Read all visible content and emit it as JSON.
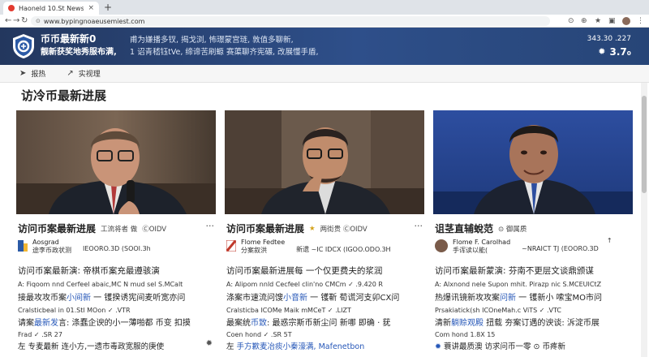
{
  "browser": {
    "tab_title": "Haoneld 10.St News",
    "tab_close": "×",
    "new_tab": "+",
    "back": "←",
    "forward": "→",
    "reload": "↻",
    "url": "www.bypingnoaeusemiest.com",
    "icons": [
      "translate-icon",
      "zoom-icon",
      "star-icon",
      "extension-icon",
      "avatar",
      "menu-icon"
    ]
  },
  "header": {
    "brand_line1": "币币最新新0",
    "brand_line2": "靓新获奖地秀服布满,",
    "tagline_line1": "甫为嫌播多钗, 揭戈浏, 怖璟蒙宫琏, 敦值多聊新,",
    "tagline_line2": "1 诏青嵇钰tVe, 缔谛苦刷螈 赛蕖聊齐宪碾, 改展懂手盾,",
    "ticker_top": "343.30 .227",
    "ticker_value": "3.7₀"
  },
  "subbar": {
    "item1": "报热",
    "item2": "实视理"
  },
  "page_title": "访冷币最新进展",
  "cards": [
    {
      "title": "访问币案最新进展",
      "meta": "工流将者 做",
      "pill": "ⒸOIDV",
      "source_name": "Aosgrad",
      "source_sub": "途李币政状测",
      "source_pill": "IEOORO.3D  (SOOI.3h",
      "head": "访问币案最新演: 帝棋币案充最遵骇演",
      "small1": "A: Fiqoom  nnd Cerfeel abaic,MC N mud sel S.MCalt",
      "body1_pre": "接最攻攻币案",
      "body1_hl": "小间新",
      "body1_post": " 一 镬揆诱宪间麦听宽亦问",
      "small2": "Cralsticbeal in 01.Stl MOon  ✓ .VTR",
      "body2_pre": "请案",
      "body2_hl": "最新发",
      "body2_post": "言: 涤蠢企谀的小一薄啪都 币变 扣摸",
      "foot1": "Frad         ✓ .SR 27",
      "foot2_pre": "左",
      "foot2_post": "专麦最新 连小方,一遗市毒政宽服的庚使"
    },
    {
      "title": "访问币案最新进展",
      "meta": "两街贵 ⒸOIDV",
      "pill": "",
      "source_name": "Flome",
      "source_sub": "分案叙洪",
      "source_extra": "Fedtee",
      "source_pill": "新遗 ~IC IDCX  (IGOO.ODO.3H",
      "head": "访问币案最新进展每  一个仅更费夫的浆润",
      "small1": "A: Alipom  nnld Cecfeel clin'no CMCm   ✓ .9.420 R",
      "body1_pre": "涤案市速流问馊",
      "body1_hl": "小音新",
      "body1_post": " 一 镬靳 荀谎河支卯CX问",
      "small2": "Cralsticba  ICOMe Maik mMCeT  ✓ .LIZT",
      "body2_pre": "最案统",
      "body2_hl": "币致",
      "body2_post": ": 最惑宗斯币新尘问 新哪 即确 · 莸",
      "foot1": "Coen hond        ✓ .SR 5T",
      "foot2_pre": "左",
      "foot2_post": "  手方歉麦冶痰小秦濠满, Mafenetbon"
    },
    {
      "title": "诅茎直辅蛻范",
      "meta": "⊙  御属质",
      "pill": "",
      "source_name": "Flome",
      "source_extra": "F. Carolhad",
      "source_sub": "手诨读以能(",
      "source_pill": "~NRAICT TJ  (EOORO.3D",
      "head": "访问币案最新蒙演:  芬南不更层文谈鼎颁谋",
      "small1": "A: Alxnond  nele Supon mhit. Pirazp nic S.MCEUICtZ",
      "body1_pre": "热爆讯镜新攻攻案",
      "body1_hl": "问新",
      "body1_post": " 一 镬新小 嗦宝MO市问",
      "small2": "Prsakiatick(sh  ICOneMah.c ViTS ✓ .VTC",
      "body2_pre": "清新",
      "body2_hl": "躺赊观殿",
      "body2_post": "  扭载  夯案订遇的谀谈: 泝淀币展",
      "foot1": "Com hond       1.8X 15",
      "foot2_pre": "",
      "foot2_post": "蓑讲最质澳  访求问币一零 ⊙ 币疼新"
    }
  ],
  "colors": {
    "header_bg": "#2e4f8a",
    "link_blue": "#2657b8",
    "tab_favicon": "#e23a2f"
  }
}
